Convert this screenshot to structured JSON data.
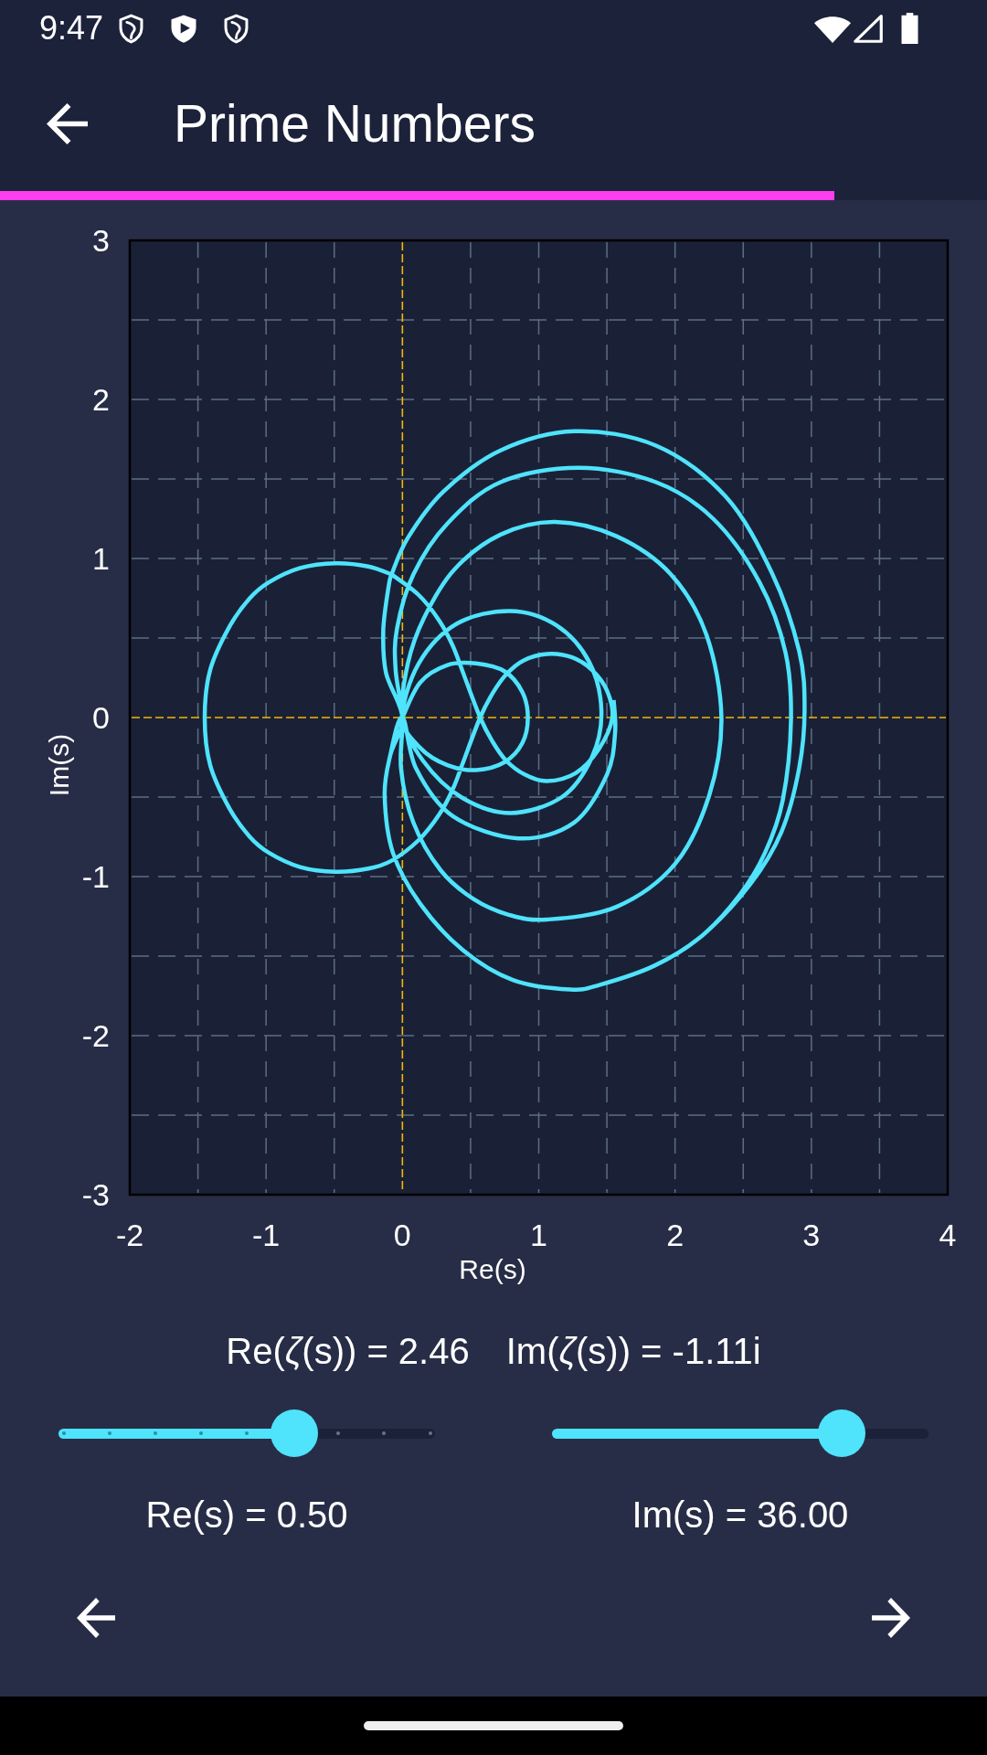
{
  "status_bar": {
    "time": "9:47"
  },
  "app_bar": {
    "title": "Prime Numbers"
  },
  "progress": {
    "level": 0.845
  },
  "plot": {
    "chart_data": {
      "type": "line",
      "xlabel": "Re(s)",
      "ylabel": "Im(s)",
      "xlim": [
        -2,
        4
      ],
      "ylim": [
        -3,
        3
      ],
      "xticks": [
        -2,
        -1,
        0,
        1,
        2,
        3,
        4
      ],
      "yticks": [
        -3,
        -2,
        -1,
        0,
        1,
        2,
        3
      ],
      "grid": true,
      "x": [
        0,
        0.13,
        0.33,
        0.54,
        0.75,
        0.88,
        0.92,
        0.88,
        0.75,
        0.54,
        0.33,
        0.13,
        0,
        0.12,
        0.4,
        0.79,
        1.13,
        1.37,
        1.46,
        1.39,
        1.17,
        0.79,
        0.43,
        0.15,
        0,
        0.04,
        0.16,
        0.38,
        0.72,
        1.12,
        1.57,
        1.97,
        2.23,
        2.34,
        2.25,
        2,
        1.57,
        1.06,
        0.78,
        0.52,
        0.28,
        0.08,
        -0.01,
        0,
        -0.05,
        -0.04,
        0.08,
        0.33,
        0.72,
        1.29,
        1.86,
        2.28,
        2.62,
        2.81,
        2.85,
        2.79,
        2.66,
        2.47,
        2.2,
        1.85,
        1.45,
        1.23,
        0.81,
        0.44,
        0.13,
        -0.07,
        -0.13,
        -0.09,
        0,
        -0.12,
        -0.14,
        -0.1,
        -0.08,
        -0.08,
        0.12,
        0.27,
        0.37,
        0.45,
        0.57,
        0.66,
        0.76,
        0.9,
        1.06,
        1.27,
        1.44,
        1.54,
        1.5,
        1.39,
        1.24,
        1.06,
        0.89,
        0.76,
        0.66,
        0.57,
        0.45,
        0.37,
        0.27,
        0.12,
        -0.08,
        -0.25,
        -0.49,
        -0.75,
        -0.98,
        -1.12,
        -1.27,
        -1.41,
        -1.45,
        -1.41,
        -1.27,
        -1.12,
        -0.98,
        -0.75,
        -0.49,
        -0.25,
        -0.08,
        -0.08,
        0.04,
        0.3,
        0.72,
        1.26,
        1.86,
        2.37,
        2.71,
        2.91,
        2.95,
        2.91,
        2.78,
        2.55,
        2.2,
        1.85,
        1.45,
        1.23,
        0.81,
        0.44,
        0.13,
        -0.07,
        -0.13,
        -0.09,
        0,
        0.1,
        0.37,
        0.85,
        1.26,
        1.5,
        1.56,
        1.55
      ],
      "series": [
        {
          "color": "#4fe3fc",
          "values": [
            0,
            0.22,
            0.33,
            0.34,
            0.29,
            0.16,
            0,
            -0.16,
            -0.28,
            -0.33,
            -0.3,
            -0.19,
            0,
            0.34,
            0.59,
            0.67,
            0.58,
            0.35,
            0.04,
            -0.25,
            -0.5,
            -0.6,
            -0.5,
            -0.27,
            0,
            0.34,
            0.63,
            0.93,
            1.15,
            1.23,
            1.14,
            0.9,
            0.52,
            0,
            -0.49,
            -0.92,
            -1.19,
            -1.27,
            -1.24,
            -1.14,
            -0.96,
            -0.66,
            -0.32,
            0,
            0.3,
            0.56,
            0.9,
            1.22,
            1.48,
            1.57,
            1.48,
            1.25,
            0.85,
            0.41,
            -0.02,
            -0.52,
            -0.85,
            -1.12,
            -1.37,
            -1.56,
            -1.68,
            -1.71,
            -1.65,
            -1.46,
            -1.17,
            -0.85,
            -0.49,
            -0.24,
            0,
            0.28,
            0.55,
            0.83,
            0.9,
            0.9,
            0.77,
            0.61,
            0.45,
            0.27,
            0,
            -0.15,
            -0.27,
            -0.36,
            -0.4,
            -0.35,
            -0.2,
            0,
            0.17,
            0.3,
            0.38,
            0.4,
            0.36,
            0.27,
            0.15,
            0,
            -0.27,
            -0.45,
            -0.61,
            -0.77,
            -0.9,
            -0.95,
            -0.97,
            -0.94,
            -0.85,
            -0.75,
            -0.57,
            -0.3,
            0,
            0.3,
            0.57,
            0.75,
            0.85,
            0.94,
            0.97,
            0.95,
            0.9,
            0.9,
            1.13,
            1.42,
            1.68,
            1.8,
            1.71,
            1.39,
            0.91,
            0.42,
            0.05,
            -0.32,
            -0.72,
            -1.05,
            -1.37,
            -1.56,
            -1.68,
            -1.71,
            -1.65,
            -1.46,
            -1.17,
            -0.85,
            -0.49,
            -0.24,
            0,
            -0.32,
            -0.62,
            -0.76,
            -0.66,
            -0.36,
            -0.1,
            0.11
          ]
        }
      ]
    }
  },
  "readout": {
    "real": "Re(*ζ*(s)) = 2.46",
    "imaginary": "Im(*ζ*(s)) = -1.11i"
  },
  "sliders": [
    {
      "kind": "stepped",
      "level": 0.625,
      "label": "Re(s) = 0.50"
    },
    {
      "kind": "continuous",
      "level": 0.77,
      "label": "Im(s) = 36.00"
    }
  ]
}
